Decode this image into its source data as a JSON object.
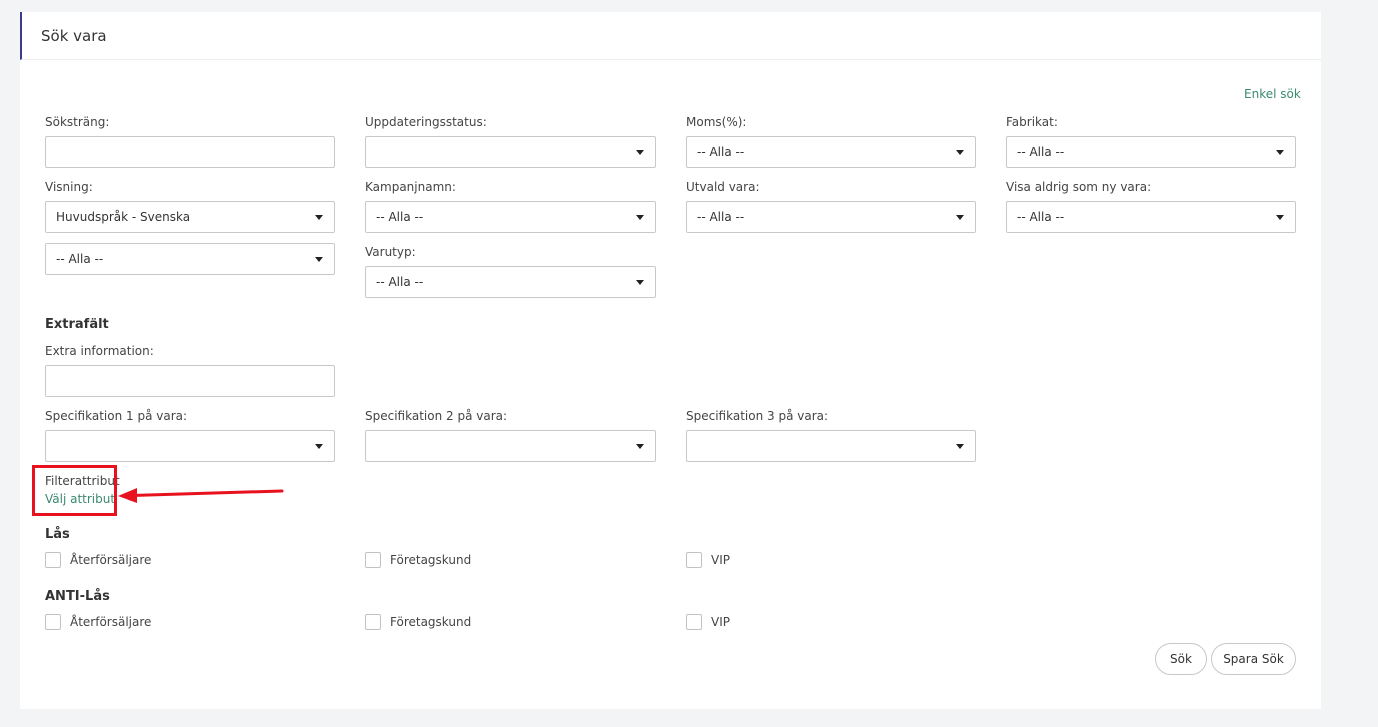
{
  "panel": {
    "title": "Sök vara",
    "simple_search_link": "Enkel sök"
  },
  "fields": {
    "search_string": {
      "label": "Söksträng:",
      "value": ""
    },
    "update_status": {
      "label": "Uppdateringsstatus:",
      "value": ""
    },
    "vat": {
      "label": "Moms(%):",
      "value": "-- Alla --"
    },
    "brand": {
      "label": "Fabrikat:",
      "value": "-- Alla --"
    },
    "display": {
      "label": "Visning:",
      "value": "Huvudspråk - Svenska",
      "second_value": "-- Alla --"
    },
    "campaign_name": {
      "label": "Kampanjnamn:",
      "value": "-- Alla --"
    },
    "featured_item": {
      "label": "Utvald vara:",
      "value": "-- Alla --"
    },
    "never_show_as_new": {
      "label": "Visa aldrig som ny vara:",
      "value": "-- Alla --"
    },
    "item_type": {
      "label": "Varutyp:",
      "value": "-- Alla --"
    }
  },
  "extra_fields": {
    "heading": "Extrafält",
    "extra_information": {
      "label": "Extra information:",
      "value": ""
    },
    "spec1": {
      "label": "Specifikation 1 på vara:",
      "value": ""
    },
    "spec2": {
      "label": "Specifikation 2 på vara:",
      "value": ""
    },
    "spec3": {
      "label": "Specifikation 3 på vara:",
      "value": ""
    }
  },
  "filter_attribute": {
    "label": "Filterattribut",
    "link": "Välj attribut"
  },
  "lock": {
    "heading": "Lås",
    "options": [
      "Återförsäljare",
      "Företagskund",
      "VIP"
    ]
  },
  "anti_lock": {
    "heading": "ANTI-Lås",
    "options": [
      "Återförsäljare",
      "Företagskund",
      "VIP"
    ]
  },
  "buttons": {
    "search": "Sök",
    "save_search": "Spara Sök"
  },
  "colors": {
    "accent": "#3a8a6e",
    "title_border": "#3c3c8c",
    "highlight": "#e8121e"
  }
}
